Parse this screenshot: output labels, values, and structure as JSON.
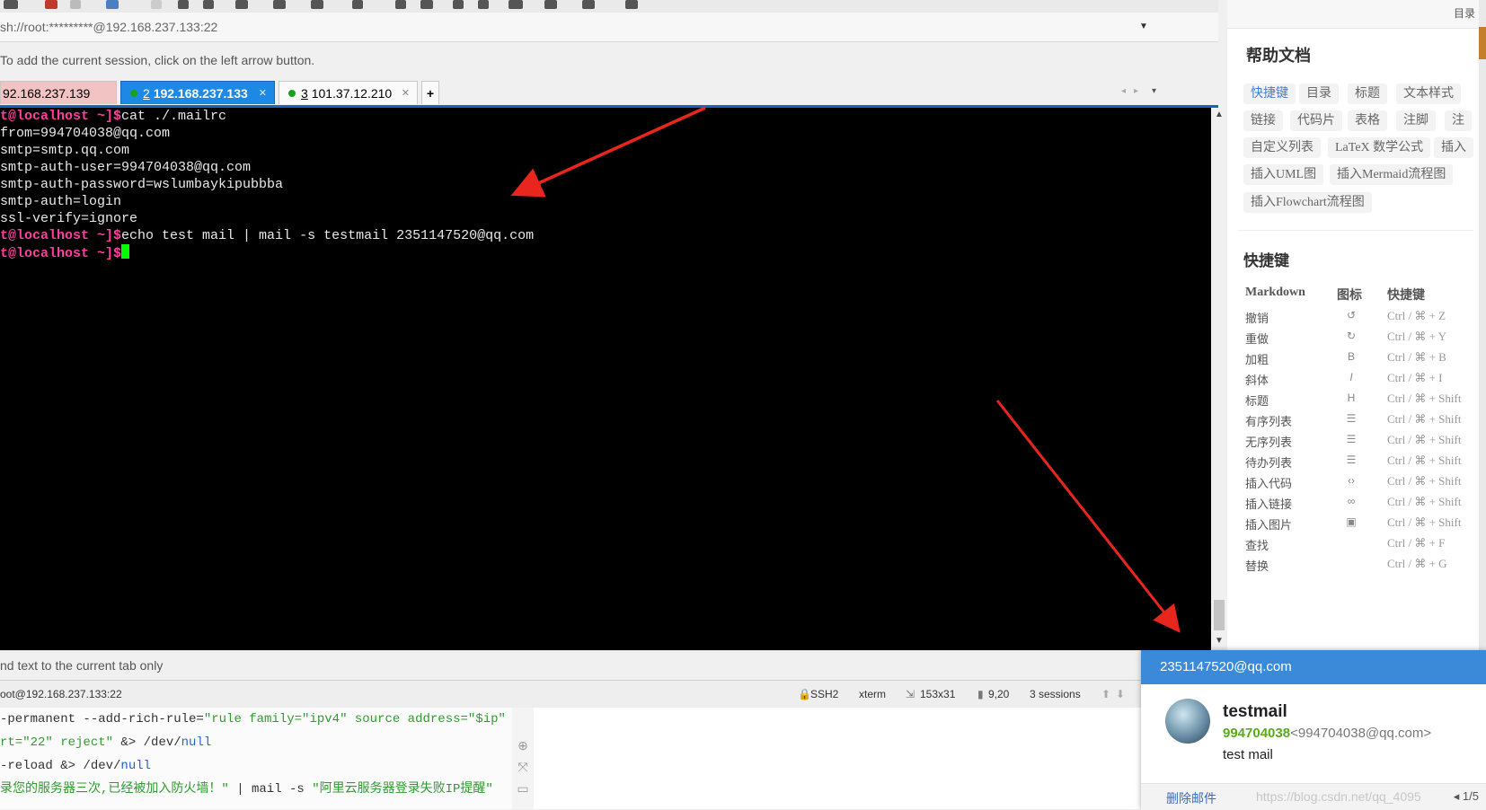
{
  "session": {
    "address": "sh://root:*********@192.168.237.133:22",
    "hint": "To add the current session, click on the left arrow button."
  },
  "tabs": [
    {
      "label": "92.168.237.139",
      "number": "",
      "active": false
    },
    {
      "label": "192.168.237.133",
      "number": "2",
      "active": true
    },
    {
      "label": "101.37.12.210",
      "number": "3",
      "active": false
    }
  ],
  "tab_add": "+",
  "terminal": {
    "lines": [
      {
        "prompt": "t@localhost ~]$",
        "text": "cat ./.mailrc"
      },
      {
        "prompt": "",
        "text": "from=994704038@qq.com"
      },
      {
        "prompt": "",
        "text": "smtp=smtp.qq.com"
      },
      {
        "prompt": "",
        "text": "smtp-auth-user=994704038@qq.com"
      },
      {
        "prompt": "",
        "text": "smtp-auth-password=wslumbaykipubbba"
      },
      {
        "prompt": "",
        "text": "smtp-auth=login"
      },
      {
        "prompt": "",
        "text": "ssl-verify=ignore"
      },
      {
        "prompt": "t@localhost ~]$",
        "text": "echo test mail | mail -s testmail 2351147520@qq.com"
      },
      {
        "prompt": "t@localhost ~]$",
        "text": ""
      }
    ]
  },
  "sendbar": {
    "text": "nd text to the current tab only"
  },
  "status": {
    "session": "oot@192.168.237.133:22",
    "protocol": "SSH2",
    "term": "xterm",
    "size": "153x31",
    "cursor": "9,20",
    "sessions": "3 sessions"
  },
  "code": {
    "line1": {
      "a": "-permanent --add-rich-rule=",
      "s1": "\"rule family=\"ipv4\" source address=\"$ip\""
    },
    "line2": {
      "s1": "rt=\"22\" reject\"",
      "a": " &> /dev/",
      "kw": "null"
    },
    "line3": {
      "a": "-reload &> /dev/",
      "kw": "null"
    },
    "line4": {
      "s1": "录您的服务器三次,已经被加入防火墙！\" ",
      "a": "| mail -s ",
      "s2": "\"阿里云服务器登录失败IP提醒\""
    }
  },
  "help": {
    "mulu": "目录",
    "title": "帮助文档",
    "chips": [
      "快捷键",
      "目录",
      "标题",
      "文本样式",
      "链接",
      "代码片",
      "表格",
      "注脚",
      "注",
      "自定义列表",
      "LaTeX 数学公式",
      "插入",
      "插入UML图",
      "插入Mermaid流程图",
      "插入Flowchart流程图"
    ],
    "section": "快捷键",
    "headers": {
      "markdown": "Markdown",
      "icon": "图标",
      "shortcut": "快捷键"
    },
    "rows": [
      {
        "name": "撤销",
        "icon": "↺",
        "key": "Ctrl / ⌘ + Z"
      },
      {
        "name": "重做",
        "icon": "↻",
        "key": "Ctrl / ⌘ + Y"
      },
      {
        "name": "加粗",
        "icon": "B",
        "key": "Ctrl / ⌘ + B"
      },
      {
        "name": "斜体",
        "icon": "I",
        "key": "Ctrl / ⌘ + I"
      },
      {
        "name": "标题",
        "icon": "H",
        "key": "Ctrl / ⌘ + Shift"
      },
      {
        "name": "有序列表",
        "icon": "☰",
        "key": "Ctrl / ⌘ + Shift"
      },
      {
        "name": "无序列表",
        "icon": "☰",
        "key": "Ctrl / ⌘ + Shift"
      },
      {
        "name": "待办列表",
        "icon": "☰",
        "key": "Ctrl / ⌘ + Shift"
      },
      {
        "name": "插入代码",
        "icon": "‹›",
        "key": "Ctrl / ⌘ + Shift"
      },
      {
        "name": "插入链接",
        "icon": "∞",
        "key": "Ctrl / ⌘ + Shift"
      },
      {
        "name": "插入图片",
        "icon": "▣",
        "key": "Ctrl / ⌘ + Shift"
      },
      {
        "name": "查找",
        "icon": "",
        "key": "Ctrl / ⌘ + F"
      },
      {
        "name": "替换",
        "icon": "",
        "key": "Ctrl / ⌘ + G"
      }
    ]
  },
  "notification": {
    "recipient": "2351147520@qq.com",
    "subject": "testmail",
    "sender_name": "994704038",
    "sender_addr": "<994704038@qq.com>",
    "body": "test mail",
    "delete": "删除邮件",
    "watermark": "https://blog.csdn.net/qq_4095",
    "page": "1/5"
  },
  "colors": {
    "accent": "#1565c0",
    "prompt": "#ff3fa0",
    "cursor": "#00ff00",
    "arrow": "#e8261e",
    "notif_header": "#3b8ad9"
  }
}
